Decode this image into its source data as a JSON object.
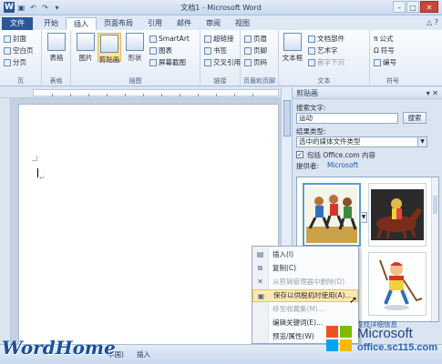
{
  "window": {
    "title": "文档1 - Microsoft Word",
    "app_icon_letter": "W"
  },
  "tabs": [
    "文件",
    "开始",
    "插入",
    "页面布局",
    "引用",
    "邮件",
    "审阅",
    "视图"
  ],
  "active_tab": "插入",
  "ribbon": {
    "pages_group": {
      "label": "页",
      "items": [
        "封面",
        "空白页",
        "分页"
      ]
    },
    "tables_group": {
      "label": "表格",
      "button": "表格"
    },
    "illustrations_group": {
      "label": "插图",
      "picture": "图片",
      "clipart": "剪贴画",
      "shapes": "形状",
      "smartart": "SmartArt",
      "chart": "图表",
      "screenshot": "屏幕截图"
    },
    "links_group": {
      "label": "链接",
      "items": [
        "超链接",
        "书签",
        "交叉引用"
      ]
    },
    "header_footer_group": {
      "label": "页眉和页脚",
      "items": [
        "页眉",
        "页脚",
        "页码"
      ]
    },
    "text_group": {
      "label": "文本",
      "textbox": "文本框",
      "items": [
        "文档部件",
        "艺术字",
        "首字下沉"
      ]
    },
    "symbols_group": {
      "label": "符号",
      "items": [
        "公式",
        "符号",
        "编号"
      ]
    }
  },
  "taskpane": {
    "title": "剪贴画",
    "search_label": "搜索文字:",
    "search_value": "运动",
    "search_button": "搜索",
    "result_type_label": "结果类型:",
    "result_type_value": "选中的媒体文件类型",
    "include_office": "包括 Office.com 内容",
    "provider_label": "提供者:",
    "provider_value": "Microsoft",
    "footer_link": "查找详细信息"
  },
  "context_menu": {
    "items": [
      {
        "label": "插入(I)",
        "icon": "insert-icon",
        "disabled": false,
        "highlight": false
      },
      {
        "label": "复制(C)",
        "icon": "copy-icon",
        "disabled": false,
        "highlight": false
      },
      {
        "label": "从剪辑管理器中删除(D)",
        "icon": "delete-icon",
        "disabled": true,
        "highlight": false
      },
      {
        "label": "保存以供脱机时使用(A)...",
        "icon": "save-offline-icon",
        "disabled": false,
        "highlight": true
      },
      {
        "label": "移至收藏集(M)...",
        "icon": "",
        "disabled": true,
        "highlight": false
      },
      {
        "label": "编辑关键词(E)...",
        "icon": "",
        "disabled": false,
        "highlight": false
      },
      {
        "label": "预览/属性(W)",
        "icon": "",
        "disabled": false,
        "highlight": false
      }
    ]
  },
  "statusbar": {
    "language": "中国)",
    "mode": "插入"
  },
  "watermarks": {
    "left": "WordHome",
    "right_brand": "Microsoft",
    "right_site": "office.sc115.com"
  },
  "colors": {
    "file_tab": "#2b5797",
    "highlight": "#fde59b",
    "watermark_blue": "#1b4f9c"
  }
}
